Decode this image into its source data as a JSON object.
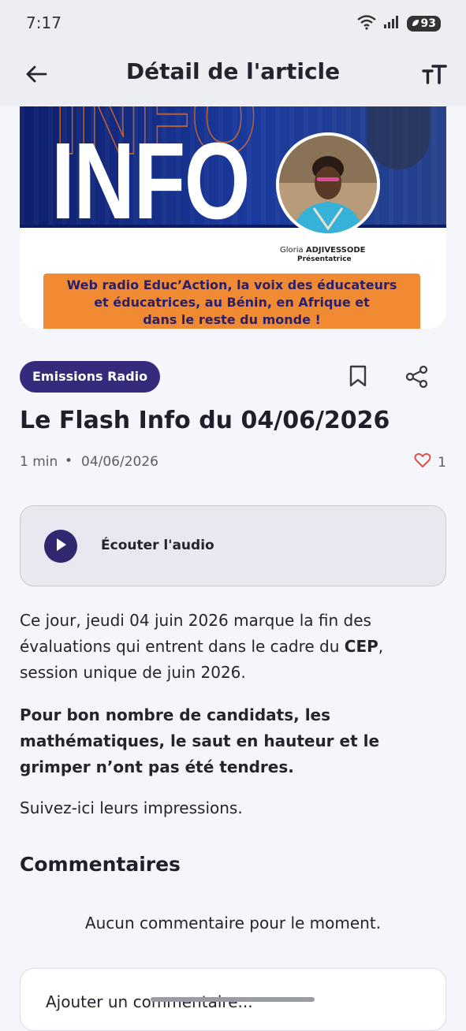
{
  "status_bar": {
    "time": "7:17",
    "battery": "93"
  },
  "app_bar": {
    "title": "Détail de l'article"
  },
  "hero": {
    "headline_word": "INFO",
    "presenter_first_name": "Gloria",
    "presenter_last_name": "ADJIVESSODE",
    "presenter_role": "Présentatrice",
    "banner_line1": "Web radio Educ’Action, la voix des éducateurs",
    "banner_line2": "et éducatrices, au Bénin, en Afrique et",
    "banner_line3": "dans le reste du monde !"
  },
  "article": {
    "category": "Emissions Radio",
    "title": "Le Flash Info du 04/06/2026",
    "read_time": "1 min",
    "separator": "•",
    "date": "04/06/2026",
    "likes": "1",
    "audio_label": "Écouter l'audio",
    "paragraph1_start": "Ce jour, jeudi 04 juin 2026 marque la fin des évaluations qui entrent dans le cadre  du ",
    "paragraph1_bold": "CEP",
    "paragraph1_end": ", session unique de juin 2026.",
    "paragraph2": "Pour bon nombre de candidats, les mathématiques, le saut en hauteur et le grimper n’ont pas été tendres.",
    "paragraph3": "Suivez-ici leurs impressions."
  },
  "comments": {
    "heading": "Commentaires",
    "empty_message": "Aucun commentaire pour le moment.",
    "input_placeholder": "Ajouter un commentaire..."
  },
  "colors": {
    "accent": "#352b7d",
    "like": "#d9534f",
    "background": "#f4f6fb"
  }
}
